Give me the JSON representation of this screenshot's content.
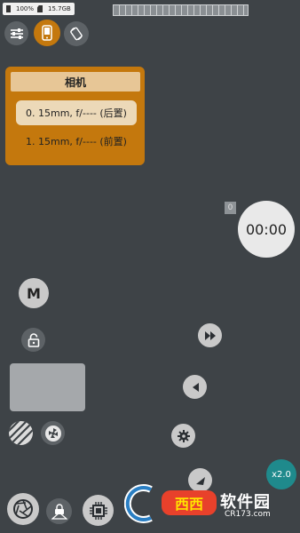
{
  "status_bar": {
    "battery": "100%",
    "storage": "15.7GB"
  },
  "camera_menu": {
    "title": "相机",
    "options": [
      {
        "label": "0. 15mm, f/---- (后置)",
        "selected": true
      },
      {
        "label": "1. 15mm, f/---- (前置)",
        "selected": false
      }
    ]
  },
  "timer": {
    "display": "00:00",
    "count": "0"
  },
  "mode_button": {
    "label": "M"
  },
  "zoom": {
    "label": "x2.0"
  },
  "watermark": {
    "text": "软件园",
    "url": "CR173.com",
    "logo_text": "西西"
  },
  "icons": {
    "settings": "sliders-icon",
    "camera_switch": "phone-camera-icon",
    "rotate": "rotate-icon",
    "lock": "lock-icon",
    "fast_forward": "fast-forward-icon",
    "play_back": "play-left-icon",
    "gear": "gear-icon",
    "pattern": "stripes-icon",
    "aperture": "aperture-icon",
    "triangle": "triangle-icon",
    "shutter": "aperture-icon",
    "exposure_lock": "exposure-icon",
    "chip": "chip-icon"
  },
  "colors": {
    "background": "#3e4347",
    "accent_orange": "#c4780d",
    "zoom_teal": "#1f8a8c"
  }
}
